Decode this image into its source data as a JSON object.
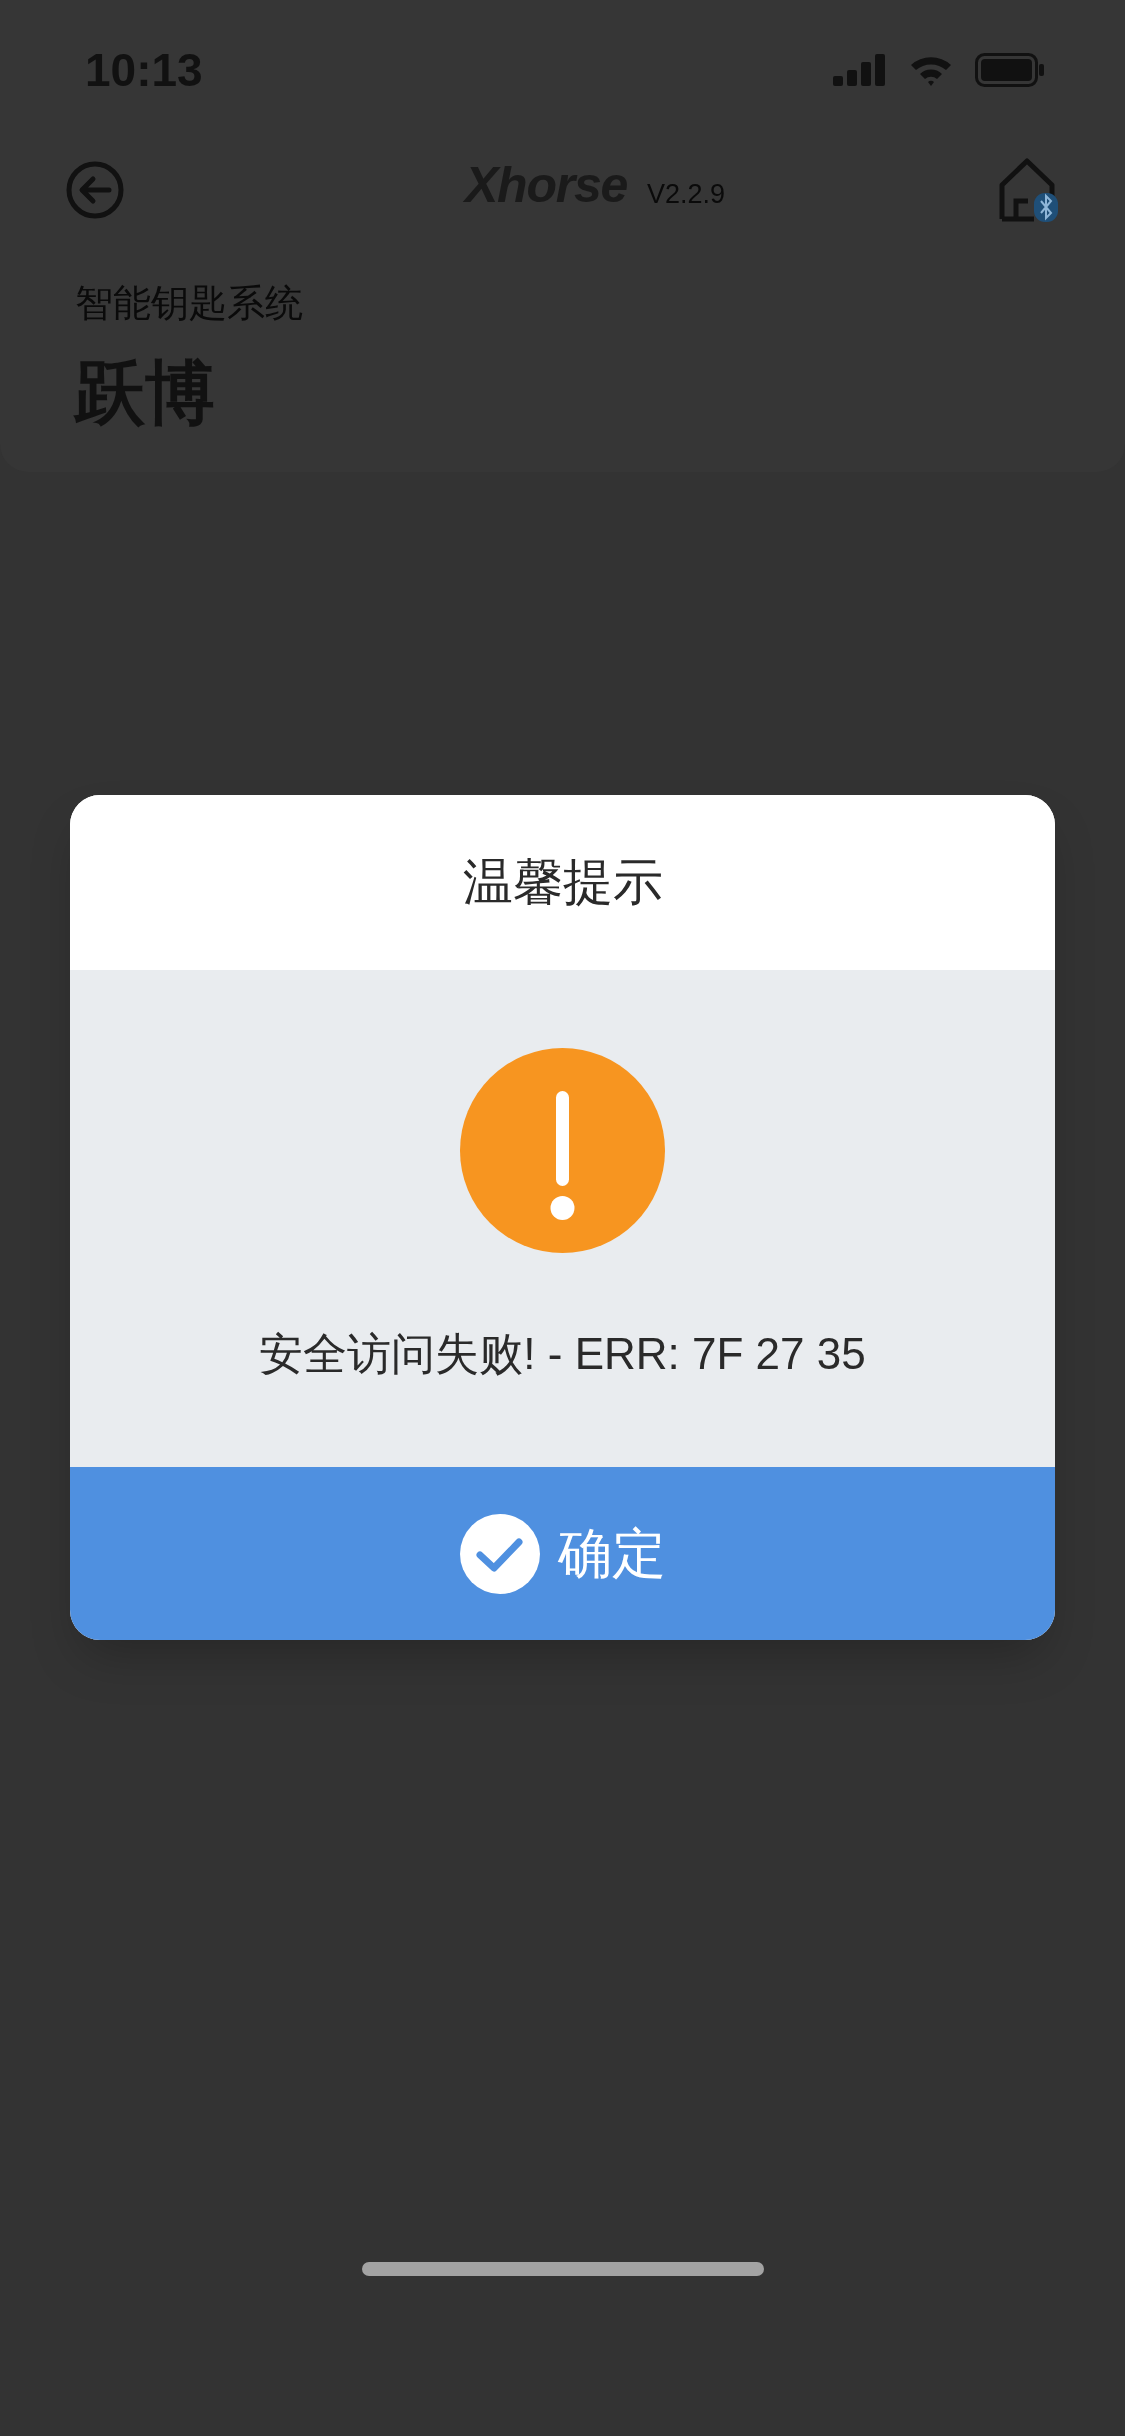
{
  "status_bar": {
    "time": "10:13"
  },
  "header": {
    "logo": "Xhorse",
    "version": "V2.2.9",
    "subtitle": "智能钥匙系统",
    "title": "跃博"
  },
  "dialog": {
    "title": "温馨提示",
    "message": "安全访问失败! - ERR: 7F 27 35",
    "button": "确定"
  }
}
